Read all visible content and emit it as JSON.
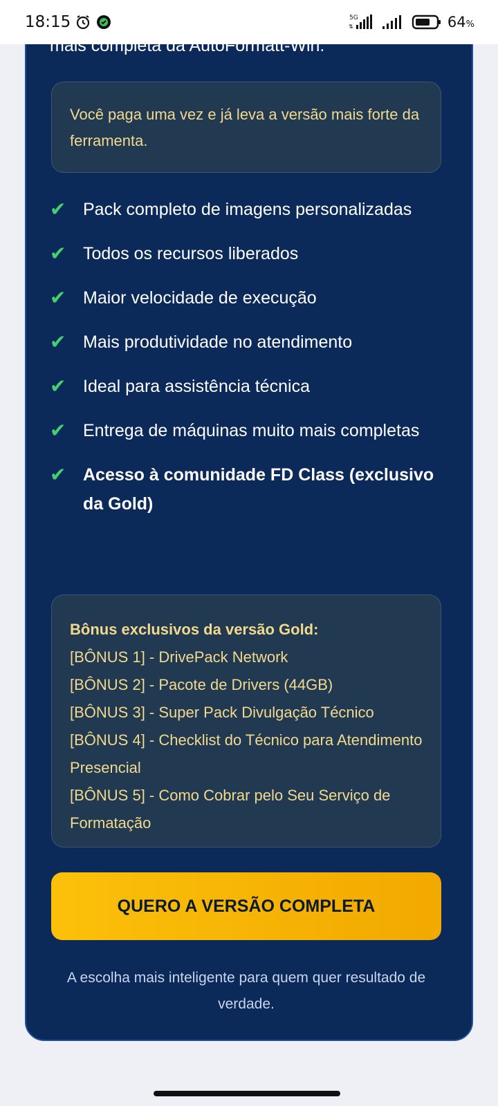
{
  "status_bar": {
    "time": "18:15",
    "network": "5G",
    "battery": "64",
    "battery_unit": "%"
  },
  "cut_text": "mais completa da AutoFormatt-Win.",
  "note": "Você paga uma vez e já leva a versão mais forte da ferramenta.",
  "features": [
    {
      "text": "Pack completo de imagens personalizadas",
      "bold": false
    },
    {
      "text": "Todos os recursos liberados",
      "bold": false
    },
    {
      "text": "Maior velocidade de execução",
      "bold": false
    },
    {
      "text": "Mais produtividade no atendimento",
      "bold": false
    },
    {
      "text": "Ideal para assistência técnica",
      "bold": false
    },
    {
      "text": "Entrega de máquinas muito mais completas",
      "bold": false
    },
    {
      "text": "Acesso à comunidade FD Class (exclusivo da Gold)",
      "bold": true
    }
  ],
  "check_glyph": "✔",
  "bonus": {
    "title": "Bônus exclusivos da versão Gold:",
    "items": [
      "[BÔNUS 1] - DrivePack Network",
      "[BÔNUS 2] - Pacote de Drivers (44GB)",
      "[BÔNUS 3] - Super Pack Divulgação Técnico",
      "[BÔNUS 4] - Checklist do Técnico para Atendimento Presencial",
      "[BÔNUS 5] - Como Cobrar pelo Seu Serviço de Formatação"
    ]
  },
  "cta": {
    "label": "QUERO A VERSÃO COMPLETA",
    "subtitle": "A escolha mais inteligente para quem quer resultado de verdade."
  },
  "colors": {
    "card_bg": "#0b2a59",
    "accent_yellow": "#fcc00a",
    "check_green": "#46d16f",
    "note_text": "#f3d98e"
  }
}
